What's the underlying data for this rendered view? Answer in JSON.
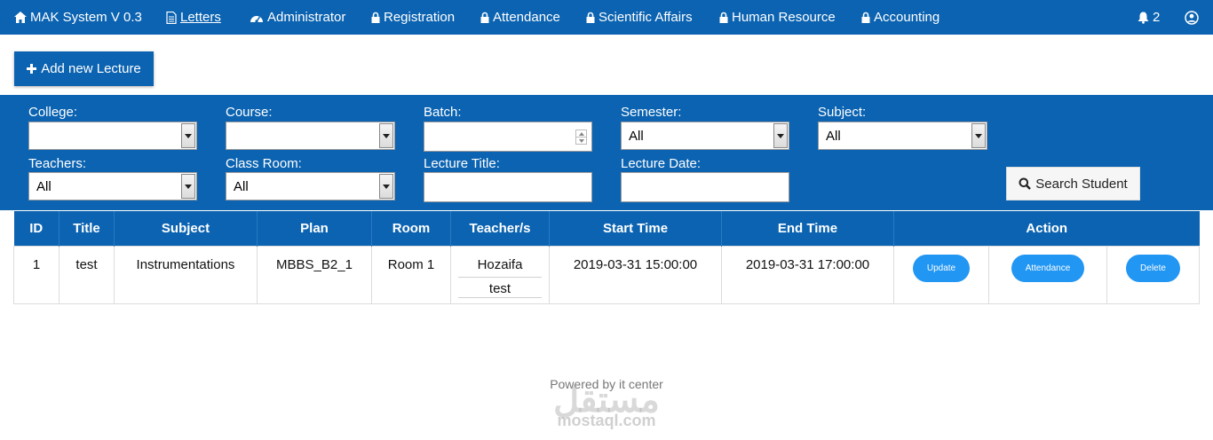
{
  "navbar": {
    "brand": "MAK System V 0.3",
    "items": [
      {
        "label": "Letters",
        "icon": "file-icon"
      },
      {
        "label": "Administrator",
        "icon": "dashboard-icon"
      },
      {
        "label": "Registration",
        "icon": "lock-icon"
      },
      {
        "label": "Attendance",
        "icon": "lock-icon"
      },
      {
        "label": "Scientific Affairs",
        "icon": "lock-icon"
      },
      {
        "label": "Human Resource",
        "icon": "lock-icon"
      },
      {
        "label": "Accounting",
        "icon": "lock-icon"
      }
    ],
    "notification_count": "2"
  },
  "actions": {
    "add_lecture_label": "Add new Lecture"
  },
  "filters": {
    "college": {
      "label": "College:",
      "value": ""
    },
    "course": {
      "label": "Course:",
      "value": ""
    },
    "batch": {
      "label": "Batch:",
      "value": ""
    },
    "semester": {
      "label": "Semester:",
      "value": "All"
    },
    "subject": {
      "label": "Subject:",
      "value": "All"
    },
    "teachers": {
      "label": "Teachers:",
      "value": "All"
    },
    "class_room": {
      "label": "Class Room:",
      "value": "All"
    },
    "lecture_title": {
      "label": "Lecture Title:",
      "value": ""
    },
    "lecture_date": {
      "label": "Lecture Date:",
      "value": ""
    },
    "search_label": "Search Student"
  },
  "table": {
    "headers": [
      "ID",
      "Title",
      "Subject",
      "Plan",
      "Room",
      "Teacher/s",
      "Start Time",
      "End Time",
      "Action"
    ],
    "rows": [
      {
        "id": "1",
        "title": "test",
        "subject": "Instrumentations",
        "plan": "MBBS_B2_1",
        "room": "Room 1",
        "teachers": [
          "Hozaifa",
          "test"
        ],
        "start_time": "2019-03-31 15:00:00",
        "end_time": "2019-03-31 17:00:00",
        "actions": [
          "Update",
          "Attendance",
          "Delete"
        ]
      }
    ]
  },
  "footer": {
    "text": "Powered by it center",
    "watermark_arabic": "مستقل",
    "watermark_latin": "mostaql.com"
  },
  "colors": {
    "primary": "#0b63b1",
    "pill": "#2196f3"
  }
}
